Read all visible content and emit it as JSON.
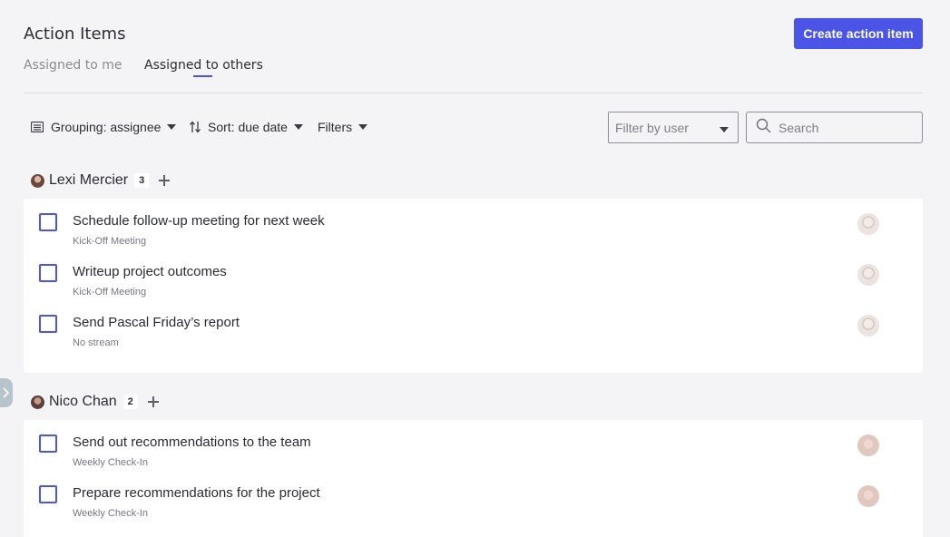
{
  "header": {
    "title": "Action Items",
    "create_button": "Create action item",
    "tabs": [
      {
        "label": "Assigned to me",
        "active": false
      },
      {
        "label": "Assigned to others",
        "active": true
      }
    ]
  },
  "toolbar": {
    "grouping_label": "Grouping: assignee",
    "sort_label": "Sort: due date",
    "filters_label": "Filters",
    "user_filter_placeholder": "Filter by user",
    "search_placeholder": "Search"
  },
  "groups": [
    {
      "name": "Lexi Mercier",
      "count": "3",
      "items": [
        {
          "title": "Schedule follow-up meeting for next week",
          "source": "Kick-Off Meeting"
        },
        {
          "title": "Writeup project outcomes",
          "source": "Kick-Off Meeting"
        },
        {
          "title": "Send Pascal Friday’s report",
          "source": "No stream"
        }
      ]
    },
    {
      "name": "Nico Chan",
      "count": "2",
      "items": [
        {
          "title": "Send out recommendations to the team",
          "source": "Weekly Check-In"
        },
        {
          "title": "Prepare recommendations for the project",
          "source": "Weekly Check-In"
        }
      ]
    }
  ],
  "colors": {
    "accent": "#4a55e8",
    "background": "#f4f4f6",
    "card": "#ffffff",
    "text": "#2a2b33",
    "muted": "#777880"
  },
  "icons": {
    "grouping": "list-icon",
    "sort": "sort-arrows-icon",
    "caret": "caret-down-icon",
    "search": "search-icon",
    "add": "plus-icon",
    "sidebar_toggle": "chevron-right-icon"
  }
}
